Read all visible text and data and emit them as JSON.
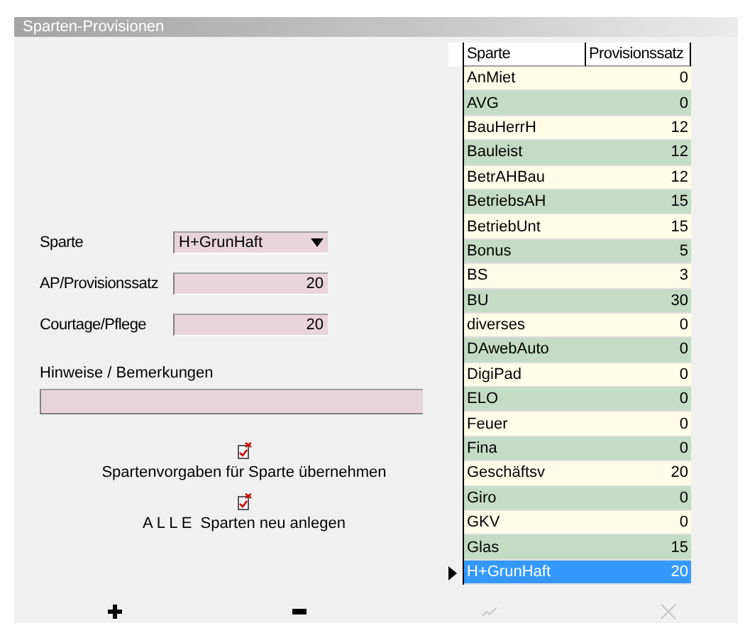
{
  "window": {
    "title": "Sparten-Provisionen"
  },
  "form": {
    "sparte": {
      "label": "Sparte",
      "value": "H+GrunHaft"
    },
    "provisionssatz": {
      "label": "AP/Provisionssatz",
      "value": "20"
    },
    "courtage": {
      "label": "Courtage/Pflege",
      "value": "20"
    },
    "hinweise": {
      "label": "Hinweise / Bemerkungen"
    }
  },
  "actions": [
    {
      "label": "Spartenvorgaben für Sparte übernehmen"
    },
    {
      "label": "A L L E  Sparten neu anlegen"
    }
  ],
  "table": {
    "columns": [
      "Sparte",
      "Provisionssatz"
    ],
    "rows": [
      {
        "sparte": "AnMiet",
        "satz": "0",
        "selected": false
      },
      {
        "sparte": "AVG",
        "satz": "0",
        "selected": false
      },
      {
        "sparte": "BauHerrH",
        "satz": "12",
        "selected": false
      },
      {
        "sparte": "Bauleist",
        "satz": "12",
        "selected": false
      },
      {
        "sparte": "BetrAHBau",
        "satz": "12",
        "selected": false
      },
      {
        "sparte": "BetriebsAH",
        "satz": "15",
        "selected": false
      },
      {
        "sparte": "BetriebUnt",
        "satz": "15",
        "selected": false
      },
      {
        "sparte": "Bonus",
        "satz": "5",
        "selected": false
      },
      {
        "sparte": "BS",
        "satz": "3",
        "selected": false
      },
      {
        "sparte": "BU",
        "satz": "30",
        "selected": false
      },
      {
        "sparte": "diverses",
        "satz": "0",
        "selected": false
      },
      {
        "sparte": "DAwebAuto",
        "satz": "0",
        "selected": false
      },
      {
        "sparte": "DigiPad",
        "satz": "0",
        "selected": false
      },
      {
        "sparte": "ELO",
        "satz": "0",
        "selected": false
      },
      {
        "sparte": "Feuer",
        "satz": "0",
        "selected": false
      },
      {
        "sparte": "Fina",
        "satz": "0",
        "selected": false
      },
      {
        "sparte": "Geschäftsv",
        "satz": "20",
        "selected": false
      },
      {
        "sparte": "Giro",
        "satz": "0",
        "selected": false
      },
      {
        "sparte": "GKV",
        "satz": "0",
        "selected": false
      },
      {
        "sparte": "Glas",
        "satz": "15",
        "selected": false
      },
      {
        "sparte": "H+GrunHaft",
        "satz": "20",
        "selected": true
      }
    ]
  },
  "toolbar": [
    {
      "kind": "add",
      "disabled": false
    },
    {
      "kind": "remove",
      "disabled": false
    },
    {
      "kind": "confirm",
      "disabled": true
    },
    {
      "kind": "cancel",
      "disabled": true
    }
  ]
}
